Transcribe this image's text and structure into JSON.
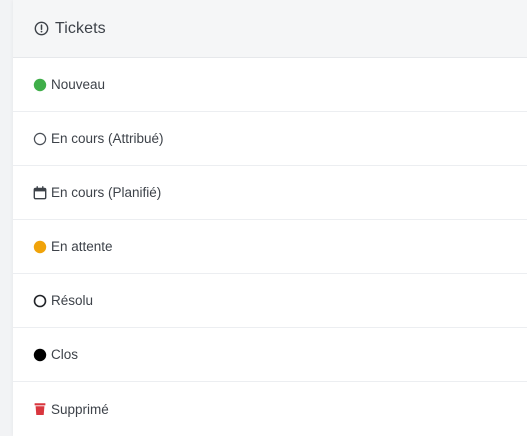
{
  "header": {
    "title": "Tickets",
    "icon": "alert-circle-icon"
  },
  "statuses": [
    {
      "label": "Nouveau",
      "icon": "filled-circle-icon",
      "color": "#3fae49"
    },
    {
      "label": "En cours (Attribué)",
      "icon": "outline-circle-icon",
      "color": "#4a4f57"
    },
    {
      "label": "En cours (Planifié)",
      "icon": "calendar-icon",
      "color": "#3d4249"
    },
    {
      "label": "En attente",
      "icon": "filled-circle-icon",
      "color": "#f0a30a"
    },
    {
      "label": "Résolu",
      "icon": "outline-circle-icon",
      "color": "#202327"
    },
    {
      "label": "Clos",
      "icon": "filled-circle-icon",
      "color": "#000000"
    },
    {
      "label": "Supprimé",
      "icon": "trash-icon",
      "color": "#d9363e"
    }
  ]
}
